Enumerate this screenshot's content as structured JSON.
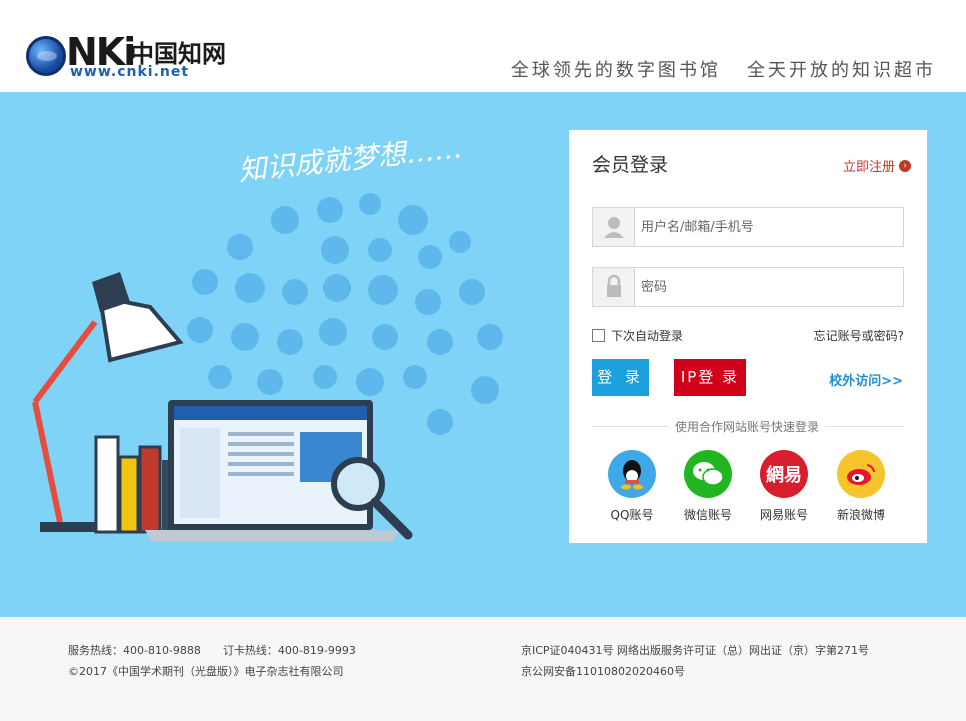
{
  "header": {
    "logo_text": "CNKi中国知网",
    "logo_nki": "NKi",
    "logo_cn": "中国知网",
    "logo_url": "www.cnki.net",
    "slogan": "全球领先的数字图书馆   全天开放的知识超市"
  },
  "banner": {
    "tagline": "知识成就梦想……",
    "background": "#7fd3f7"
  },
  "login": {
    "title": "会员登录",
    "register": "立即注册",
    "username_placeholder": "用户名/邮箱/手机号",
    "password_placeholder": "密码",
    "remember": "下次自动登录",
    "forgot": "忘记账号或密码?",
    "login_button": "登 录",
    "ip_login_button": "IP登 录",
    "offsite": "校外访问>>",
    "quick_login": "使用合作网站账号快速登录",
    "social": [
      {
        "label": "QQ账号",
        "icon": "qq-icon"
      },
      {
        "label": "微信账号",
        "icon": "wechat-icon"
      },
      {
        "label": "网易账号",
        "icon": "netease-icon",
        "glyph": "網易"
      },
      {
        "label": "新浪微博",
        "icon": "weibo-icon"
      }
    ],
    "colors": {
      "login": "#1da0de",
      "ip_login": "#d0021b",
      "register": "#c0392b"
    }
  },
  "footer": {
    "service_hotline": "服务热线：400-810-9888",
    "order_hotline": "订卡热线：400-819-9993",
    "copyright": "©2017《中国学术期刊（光盘版）》电子杂志社有限公司",
    "icp": "京ICP证040431号 网络出版服务许可证（总）网出证（京）字第271号",
    "police": "京公网安备11010802020460号"
  }
}
